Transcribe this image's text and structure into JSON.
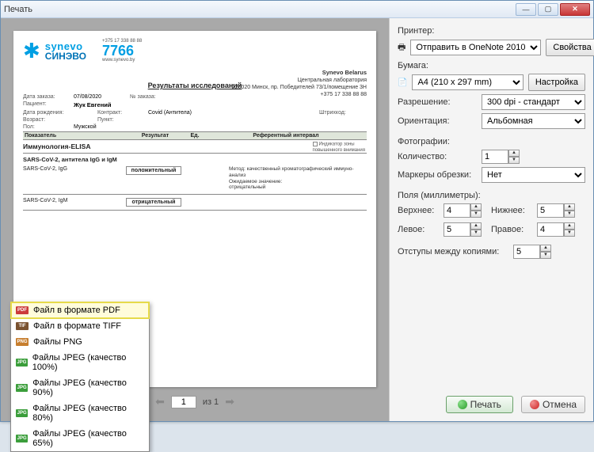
{
  "window": {
    "title": "Печать"
  },
  "printer": {
    "label": "Принтер:",
    "selected": "Отправить в OneNote 2010",
    "properties_btn": "Свойства"
  },
  "paper": {
    "label": "Бумага:",
    "selected": "A4 (210 x 297 mm)",
    "settings_btn": "Настройка",
    "resolution_label": "Разрешение:",
    "resolution_value": "300 dpi - стандарт",
    "orientation_label": "Ориентация:",
    "orientation_value": "Альбомная"
  },
  "photos": {
    "label": "Фотографии:",
    "count_label": "Количество:",
    "count_value": "1",
    "crop_label": "Маркеры обрезки:",
    "crop_value": "Нет"
  },
  "margins": {
    "label": "Поля (миллиметры):",
    "top_label": "Верхнее:",
    "top": "4",
    "bottom_label": "Нижнее:",
    "bottom": "5",
    "left_label": "Левое:",
    "left": "5",
    "right_label": "Правое:",
    "right": "4",
    "gap_label": "Отступы между копиями:",
    "gap": "5"
  },
  "buttons": {
    "print": "Печать",
    "cancel": "Отмена"
  },
  "pager": {
    "current": "1",
    "of_label": "из 1"
  },
  "export_menu": {
    "items": [
      "Файл в формате PDF",
      "Файл в формате TIFF",
      "Файлы PNG",
      "Файлы JPEG (качество 100%)",
      "Файлы JPEG (качество 90%)",
      "Файлы JPEG (качество 80%)",
      "Файлы JPEG (качество 65%)"
    ]
  },
  "doc": {
    "brand_top": "synevo",
    "brand_bottom": "СИНЭВО",
    "phone_small": "+375 17 338 88 88",
    "phone_big": "7766",
    "site": "www.synevo.by",
    "hdr_company": "Synevo Belarus",
    "hdr_lab": "Центральная лаборатория",
    "hdr_addr": "220020 Минск, пр. Победителей 73/1/помещение 3Н",
    "hdr_phone": "+375 17 338 88 88",
    "title": "Результаты исследований",
    "meta": {
      "order_date_lbl": "Дата заказа:",
      "order_date": "07/08/2020",
      "order_no_lbl": "№ заказа:",
      "patient_lbl": "Пациент:",
      "patient": "Жук Евгений",
      "dob_lbl": "Дата рождения:",
      "contract_lbl": "Контракт:",
      "contract": "Covid (Антитела)",
      "barcode_lbl": "Штрихкод:",
      "age_lbl": "Возраст:",
      "point_lbl": "Пункт:",
      "sex_lbl": "Пол:",
      "sex": "Мужской"
    },
    "legend1": "Индикатор зоны",
    "legend2": "повышенного внимания",
    "col_indicator": "Показатель",
    "col_result": "Результат",
    "col_unit": "Ед.",
    "col_ref": "Референтный интервал",
    "section": "Иммунология-ELISA",
    "subsection": "SARS-CoV-2, антитела IgG и IgM",
    "rows": [
      {
        "name": "SARS-CoV-2, IgG",
        "result": "положительный",
        "note": "Метод: качественный хроматографический иммуно-\nанализ\nОжидаемое значение:\nотрицательный"
      },
      {
        "name": "SARS-CoV-2, IgM",
        "result": "отрицательный",
        "note": ""
      }
    ]
  }
}
